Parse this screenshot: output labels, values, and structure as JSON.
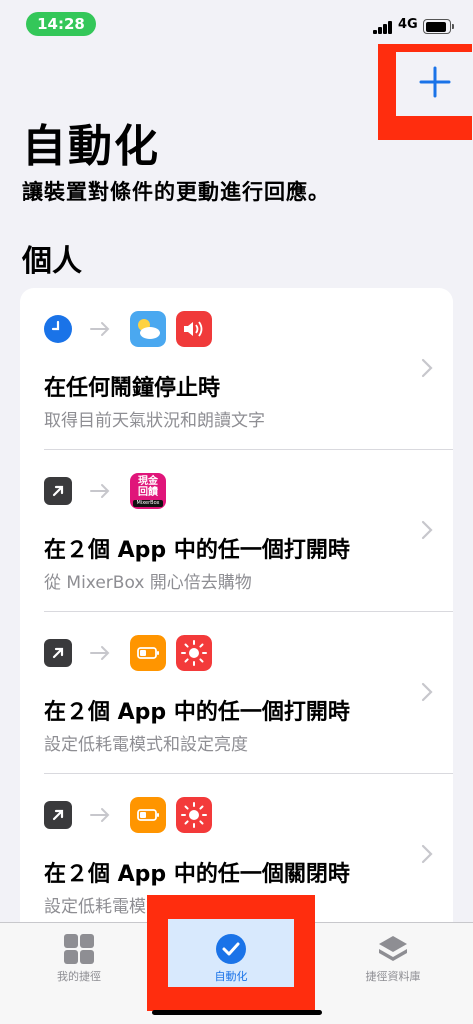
{
  "status_bar": {
    "time": "14:28",
    "network": "4G"
  },
  "header": {
    "title": "自動化",
    "subtitle": "讓裝置對條件的更動進行回應。",
    "section": "個人"
  },
  "automations": [
    {
      "title": "在任何鬧鐘停止時",
      "description": "取得目前天氣狀況和朗讀文字",
      "trigger_icon": "clock-icon",
      "apps": [
        "weather-icon",
        "speaker-icon"
      ]
    },
    {
      "title": "在２個 App 中的任一個打開時",
      "description": "從 MixerBox 開心倍去購物",
      "trigger_icon": "open-app-icon",
      "apps": [
        "mixerbox-app-icon"
      ],
      "app_text": {
        "line1": "現金",
        "line2": "回饋",
        "brand": "MixerBox"
      }
    },
    {
      "title": "在２個 App 中的任一個打開時",
      "description": "設定低耗電模式和設定亮度",
      "trigger_icon": "open-app-icon",
      "apps": [
        "low-power-icon",
        "brightness-icon"
      ]
    },
    {
      "title": "在２個 App 中的任一個關閉時",
      "description": "設定低耗電模式和設定亮度",
      "trigger_icon": "open-app-icon",
      "apps": [
        "low-power-icon",
        "brightness-icon"
      ]
    }
  ],
  "tabs": [
    {
      "label": "我的捷徑",
      "icon": "grid-icon",
      "active": false
    },
    {
      "label": "自動化",
      "icon": "automation-check-icon",
      "active": true
    },
    {
      "label": "捷徑資料庫",
      "icon": "layers-icon",
      "active": false
    }
  ],
  "colors": {
    "accent": "#1a73e8",
    "highlight": "#ff2d0e",
    "weather": "#4aa8f0",
    "speaker": "#f03a3a",
    "power": "#ff9500",
    "brightness": "#f33a3a"
  }
}
